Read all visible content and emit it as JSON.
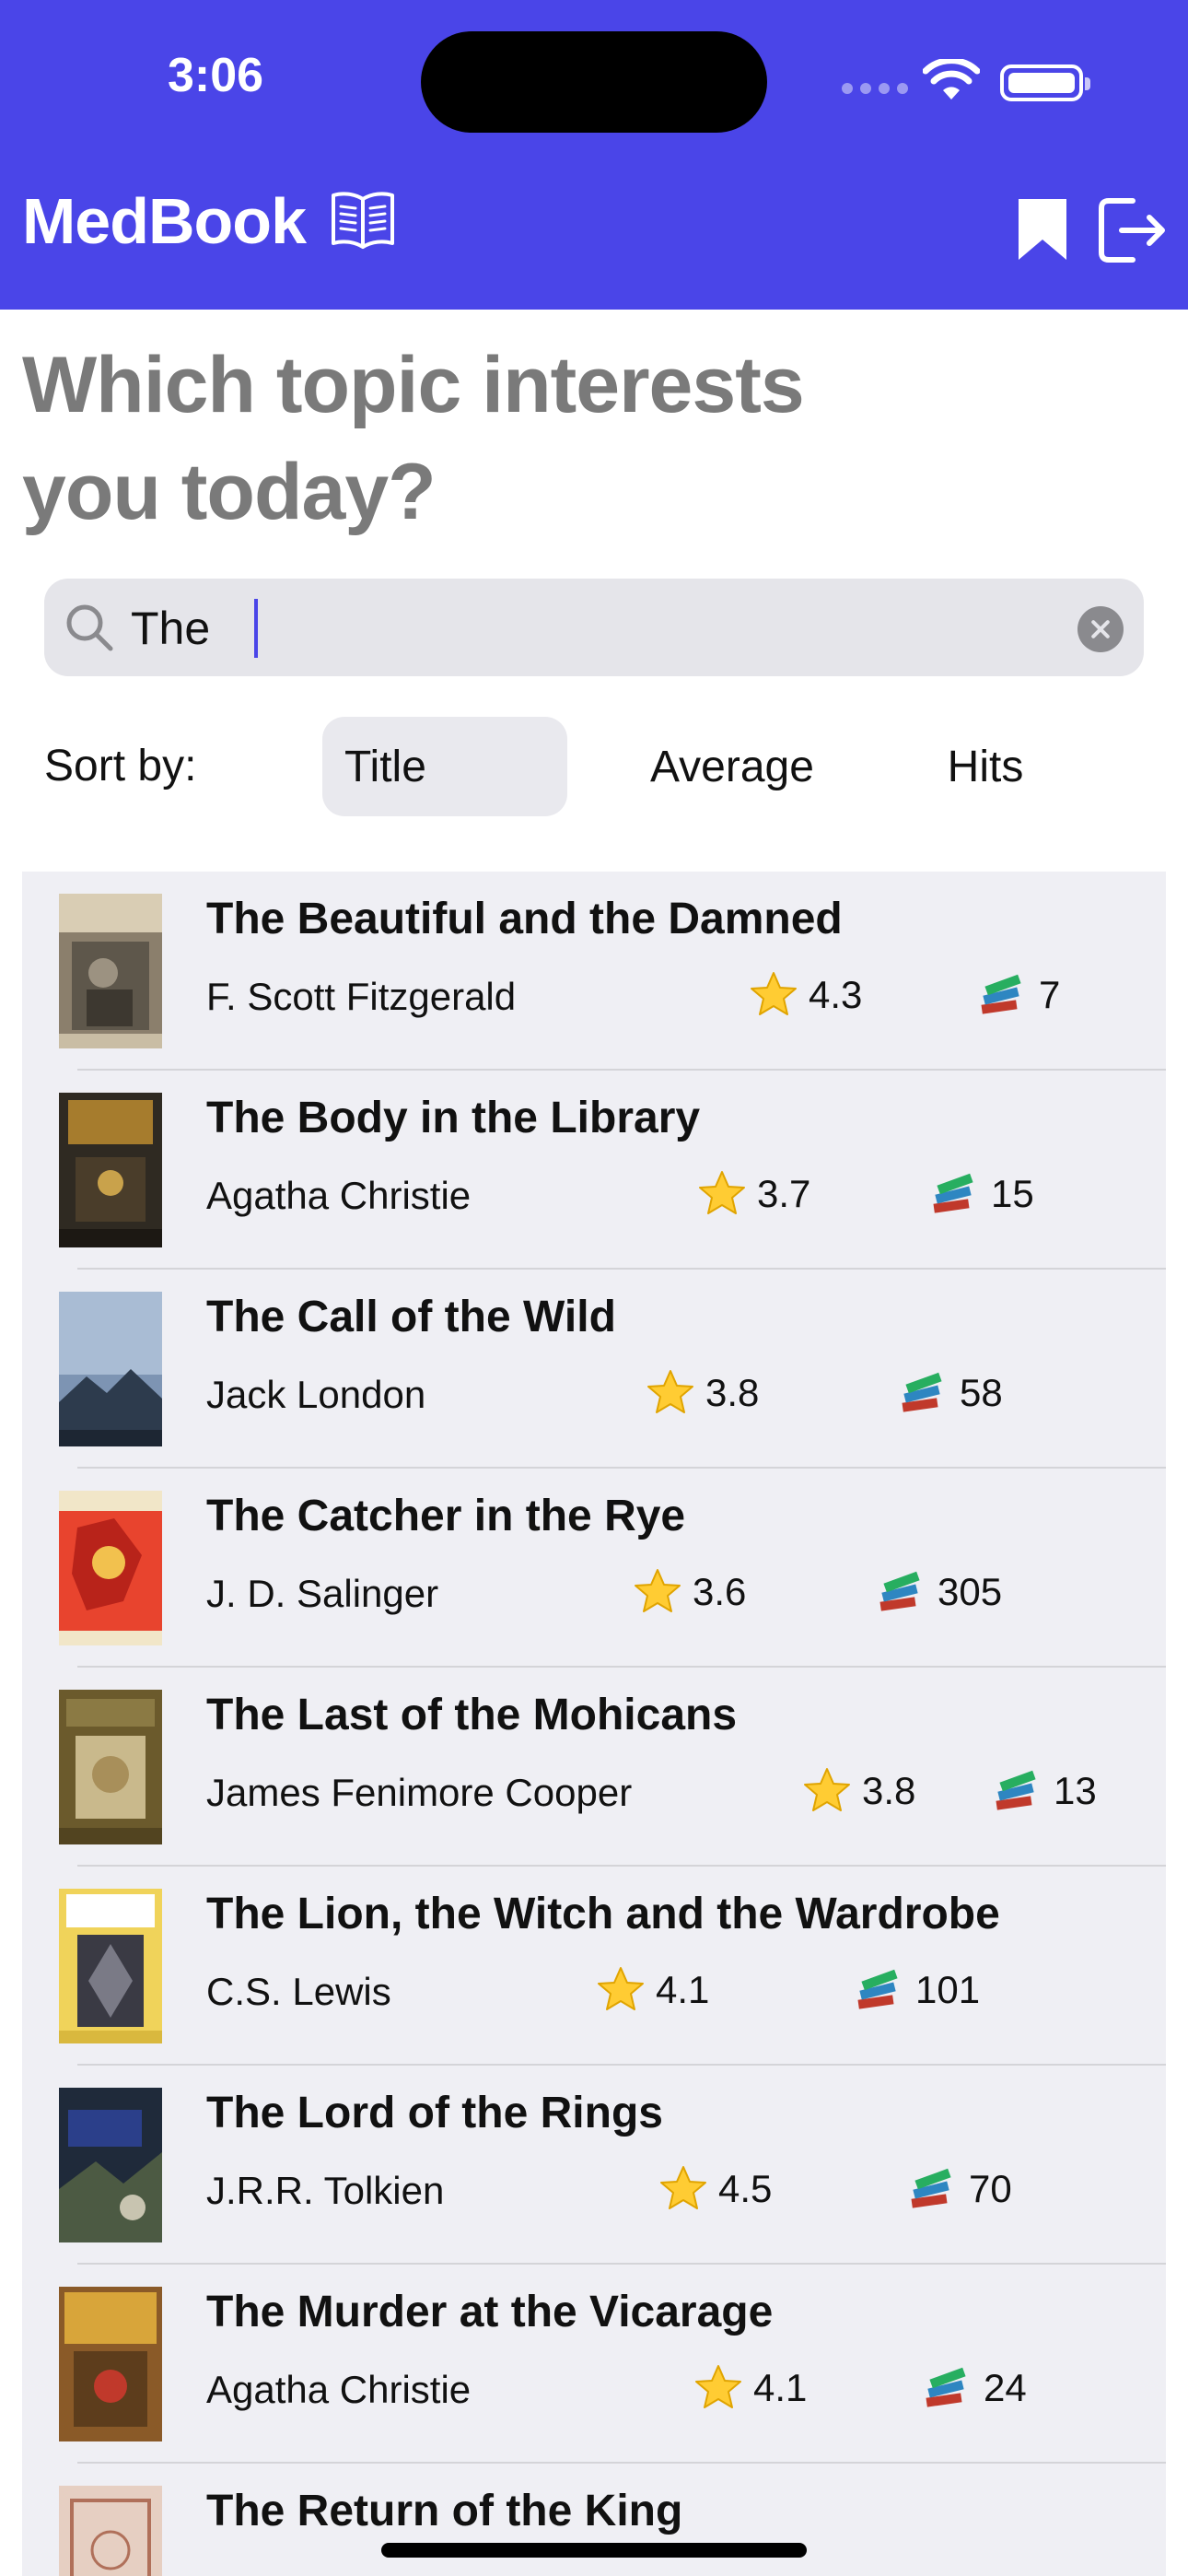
{
  "status": {
    "time": "3:06"
  },
  "header": {
    "app_title": "MedBook"
  },
  "heading": "Which topic interests you today?",
  "search": {
    "value": "The"
  },
  "sort": {
    "label": "Sort by:",
    "options": [
      "Title",
      "Average",
      "Hits"
    ],
    "selected": "Title"
  },
  "colors": {
    "accent": "#4a45e8",
    "list_background": "#efeff4"
  },
  "books": [
    {
      "title": "The Beautiful and the Damned",
      "author": "F. Scott Fitzgerald",
      "rating": "4.3",
      "hits": "7"
    },
    {
      "title": "The Body in the Library",
      "author": "Agatha Christie",
      "rating": "3.7",
      "hits": "15"
    },
    {
      "title": "The Call of the Wild",
      "author": "Jack London",
      "rating": "3.8",
      "hits": "58"
    },
    {
      "title": "The Catcher in the Rye",
      "author": "J. D. Salinger",
      "rating": "3.6",
      "hits": "305"
    },
    {
      "title": "The Last of the Mohicans",
      "author": "James Fenimore Cooper",
      "rating": "3.8",
      "hits": "13"
    },
    {
      "title": "The Lion, the Witch and the Wardrobe",
      "author": "C.S. Lewis",
      "rating": "4.1",
      "hits": "101"
    },
    {
      "title": "The Lord of the Rings",
      "author": "J.R.R. Tolkien",
      "rating": "4.5",
      "hits": "70"
    },
    {
      "title": "The Murder at the Vicarage",
      "author": "Agatha Christie",
      "rating": "4.1",
      "hits": "24"
    },
    {
      "title": "The Return of the King",
      "author": "",
      "rating": "",
      "hits": ""
    }
  ]
}
